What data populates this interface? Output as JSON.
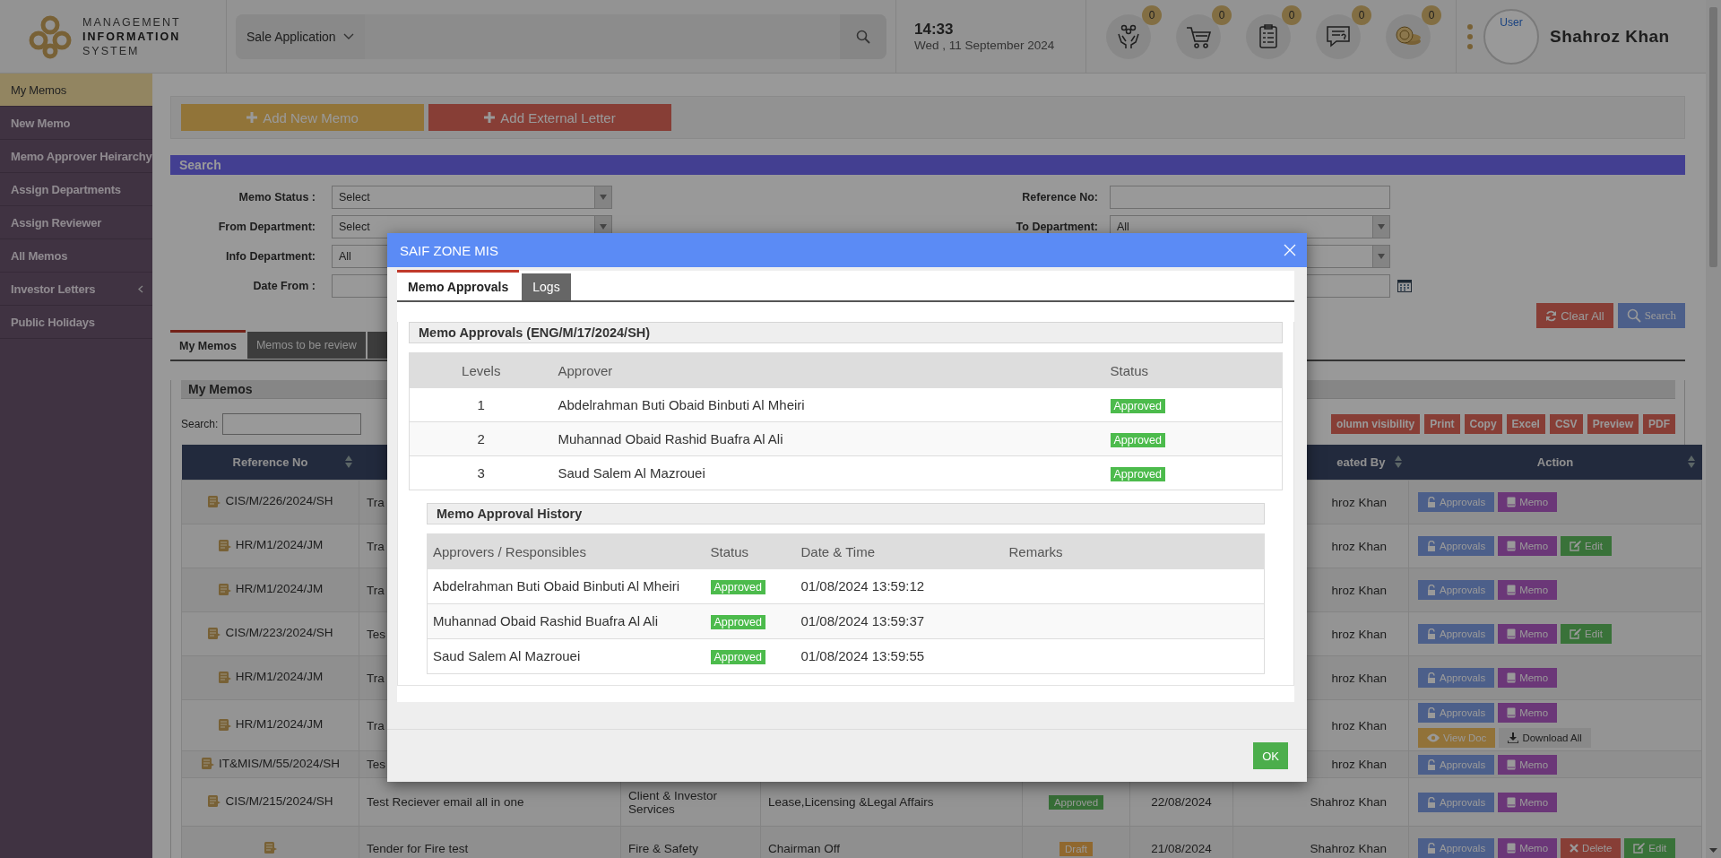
{
  "header": {
    "logo_lines": [
      "MANAGEMENT",
      "INFORMATION",
      "SYSTEM"
    ],
    "app_select": "Sale Application",
    "time": "14:33",
    "date": "Wed , 11 September 2024",
    "notifications": [
      {
        "kind": "hands",
        "count": "0"
      },
      {
        "kind": "cart",
        "count": "0"
      },
      {
        "kind": "checklist",
        "count": "0"
      },
      {
        "kind": "chat",
        "count": "0"
      },
      {
        "kind": "coins",
        "count": "0"
      }
    ],
    "avatar_alt": "User",
    "user_name": "Shahroz Khan"
  },
  "sidebar": {
    "items": [
      {
        "label": "My Memos",
        "selected": true,
        "expandable": false
      },
      {
        "label": "New Memo",
        "selected": false,
        "expandable": false
      },
      {
        "label": "Memo Approver Heirarchy",
        "selected": false,
        "expandable": false
      },
      {
        "label": "Assign Departments",
        "selected": false,
        "expandable": false
      },
      {
        "label": "Assign Reviewer",
        "selected": false,
        "expandable": false
      },
      {
        "label": "All Memos",
        "selected": false,
        "expandable": false
      },
      {
        "label": "Investor Letters",
        "selected": false,
        "expandable": true
      },
      {
        "label": "Public Holidays",
        "selected": false,
        "expandable": false
      }
    ]
  },
  "action_buttons": [
    {
      "label": "Add New Memo",
      "kind": "memo"
    },
    {
      "label": "Add External Letter",
      "kind": "letter"
    }
  ],
  "search_panel": {
    "title": "Search",
    "rows": [
      {
        "left": {
          "label": "Memo Status :",
          "kind": "select",
          "value": "Select"
        },
        "right": {
          "label": "Reference No:",
          "kind": "text"
        }
      },
      {
        "left": {
          "label": "From Department:",
          "kind": "select",
          "value": "Select"
        },
        "right": {
          "label": "To Department:",
          "kind": "select",
          "value": "All"
        }
      },
      {
        "left": {
          "label": "Info Department:",
          "kind": "select",
          "value": "All"
        },
        "right": {
          "kind": "select"
        }
      },
      {
        "left": {
          "label": "Date From :",
          "kind": "text"
        },
        "right": {
          "kind": "date"
        }
      }
    ],
    "buttons": [
      {
        "label": "Clear All",
        "kind": "clear"
      },
      {
        "label": "Search",
        "kind": "search"
      }
    ]
  },
  "tabs": [
    {
      "label": "My Memos",
      "selected": true
    },
    {
      "label": "Memos to be review",
      "selected": false
    },
    {
      "selected": false
    }
  ],
  "memos_panel": {
    "title": "My Memos",
    "search_label": "Search:",
    "export_buttons": [
      "olumn visibility",
      "Print",
      "Copy",
      "Excel",
      "CSV",
      "Preview",
      "PDF"
    ],
    "columns": [
      {
        "label": "Reference No"
      },
      {
        "label": "eated By"
      },
      {
        "label": "Action"
      }
    ],
    "rows": [
      {
        "reference": "CIS/M/226/2024/SH",
        "title": "Tra",
        "created_by": "hroz Khan",
        "actions": [
          {
            "label": "Approvals",
            "kind": "approvals"
          },
          {
            "label": "Memo",
            "kind": "memo"
          }
        ]
      },
      {
        "reference": "HR/M1/2024/JM",
        "title": "Tra",
        "created_by": "hroz Khan",
        "actions": [
          {
            "label": "Approvals",
            "kind": "approvals"
          },
          {
            "label": "Memo",
            "kind": "memo"
          },
          {
            "label": "Edit",
            "kind": "edit"
          }
        ]
      },
      {
        "reference": "HR/M1/2024/JM",
        "title": "Tra",
        "created_by": "hroz Khan",
        "actions": [
          {
            "label": "Approvals",
            "kind": "approvals"
          },
          {
            "label": "Memo",
            "kind": "memo"
          }
        ]
      },
      {
        "reference": "CIS/M/223/2024/SH",
        "title": "Tes",
        "created_by": "hroz Khan",
        "actions": [
          {
            "label": "Approvals",
            "kind": "approvals"
          },
          {
            "label": "Memo",
            "kind": "memo"
          },
          {
            "label": "Edit",
            "kind": "edit"
          }
        ]
      },
      {
        "reference": "HR/M1/2024/JM",
        "title": "Tra",
        "created_by": "hroz Khan",
        "actions": [
          {
            "label": "Approvals",
            "kind": "approvals"
          },
          {
            "label": "Memo",
            "kind": "memo"
          }
        ]
      },
      {
        "reference": "HR/M1/2024/JM",
        "title": "Tra",
        "created_by": "hroz Khan",
        "actions": [
          {
            "label": "Approvals",
            "kind": "approvals"
          },
          {
            "label": "Memo",
            "kind": "memo"
          },
          {
            "label": "View Doc",
            "kind": "view"
          },
          {
            "label": "Download All",
            "kind": "download"
          }
        ]
      },
      {
        "reference": "IT&MIS/M/55/2024/SH",
        "title": "Tes",
        "created_by": "hroz Khan",
        "actions": [
          {
            "label": "Approvals",
            "kind": "approvals"
          },
          {
            "label": "Memo",
            "kind": "memo"
          }
        ]
      },
      {
        "reference": "CIS/M/215/2024/SH",
        "title": "Test Reciever email all in one",
        "from_department": "Client & Investor Services",
        "to_department": "Lease,Licensing &Legal Affairs",
        "status": {
          "label": "Approved",
          "kind": "approved"
        },
        "date": "22/08/2024",
        "created_by": "Shahroz Khan",
        "actions": [
          {
            "label": "Approvals",
            "kind": "approvals"
          },
          {
            "label": "Memo",
            "kind": "memo"
          }
        ]
      },
      {
        "title": "Tender for Fire test",
        "from_department": "Fire & Safety",
        "to_department": "Chairman Off",
        "status": {
          "label": "Draft",
          "kind": "draft"
        },
        "date": "21/08/2024",
        "created_by": "Shahroz Khan",
        "actions": [
          {
            "label": "Approvals",
            "kind": "approvals"
          },
          {
            "label": "Memo",
            "kind": "memo"
          },
          {
            "label": "Delete",
            "kind": "delete"
          },
          {
            "label": "Edit",
            "kind": "edit"
          }
        ]
      }
    ]
  },
  "modal": {
    "title": "SAIF ZONE MIS",
    "tabs": [
      {
        "label": "Memo Approvals",
        "selected": true
      },
      {
        "label": "Logs",
        "selected": false
      }
    ],
    "approvals": {
      "title": "Memo Approvals (ENG/M/17/2024/SH)",
      "columns": [
        "Levels",
        "Approver",
        "Status"
      ],
      "rows": [
        {
          "level": "1",
          "approver": "Abdelrahman Buti Obaid Binbuti Al Mheiri",
          "status": "Approved",
          "color": "#4cbb4c"
        },
        {
          "level": "2",
          "approver": "Muhannad Obaid Rashid Buafra Al Ali",
          "status": "Approved",
          "color": "#4cbb4c"
        },
        {
          "level": "3",
          "approver": "Saud Salem Al Mazrouei",
          "status": "Approved",
          "color": "#4cbb4c"
        }
      ]
    },
    "history": {
      "title": "Memo Approval History",
      "columns": [
        "Approvers / Responsibles",
        "Status",
        "Date & Time",
        "Remarks"
      ],
      "rows": [
        {
          "approver": "Abdelrahman Buti Obaid Binbuti Al Mheiri",
          "status": "Approved",
          "color": "#4cbb4c",
          "datetime": "01/08/2024 13:59:12"
        },
        {
          "approver": "Muhannad Obaid Rashid Buafra Al Ali",
          "status": "Approved",
          "color": "#4cbb4c",
          "datetime": "01/08/2024 13:59:37"
        },
        {
          "approver": "Saud Salem Al Mazrouei",
          "status": "Approved",
          "color": "#4cbb4c",
          "datetime": "01/08/2024 13:59:55"
        }
      ]
    },
    "ok_button": "OK"
  }
}
